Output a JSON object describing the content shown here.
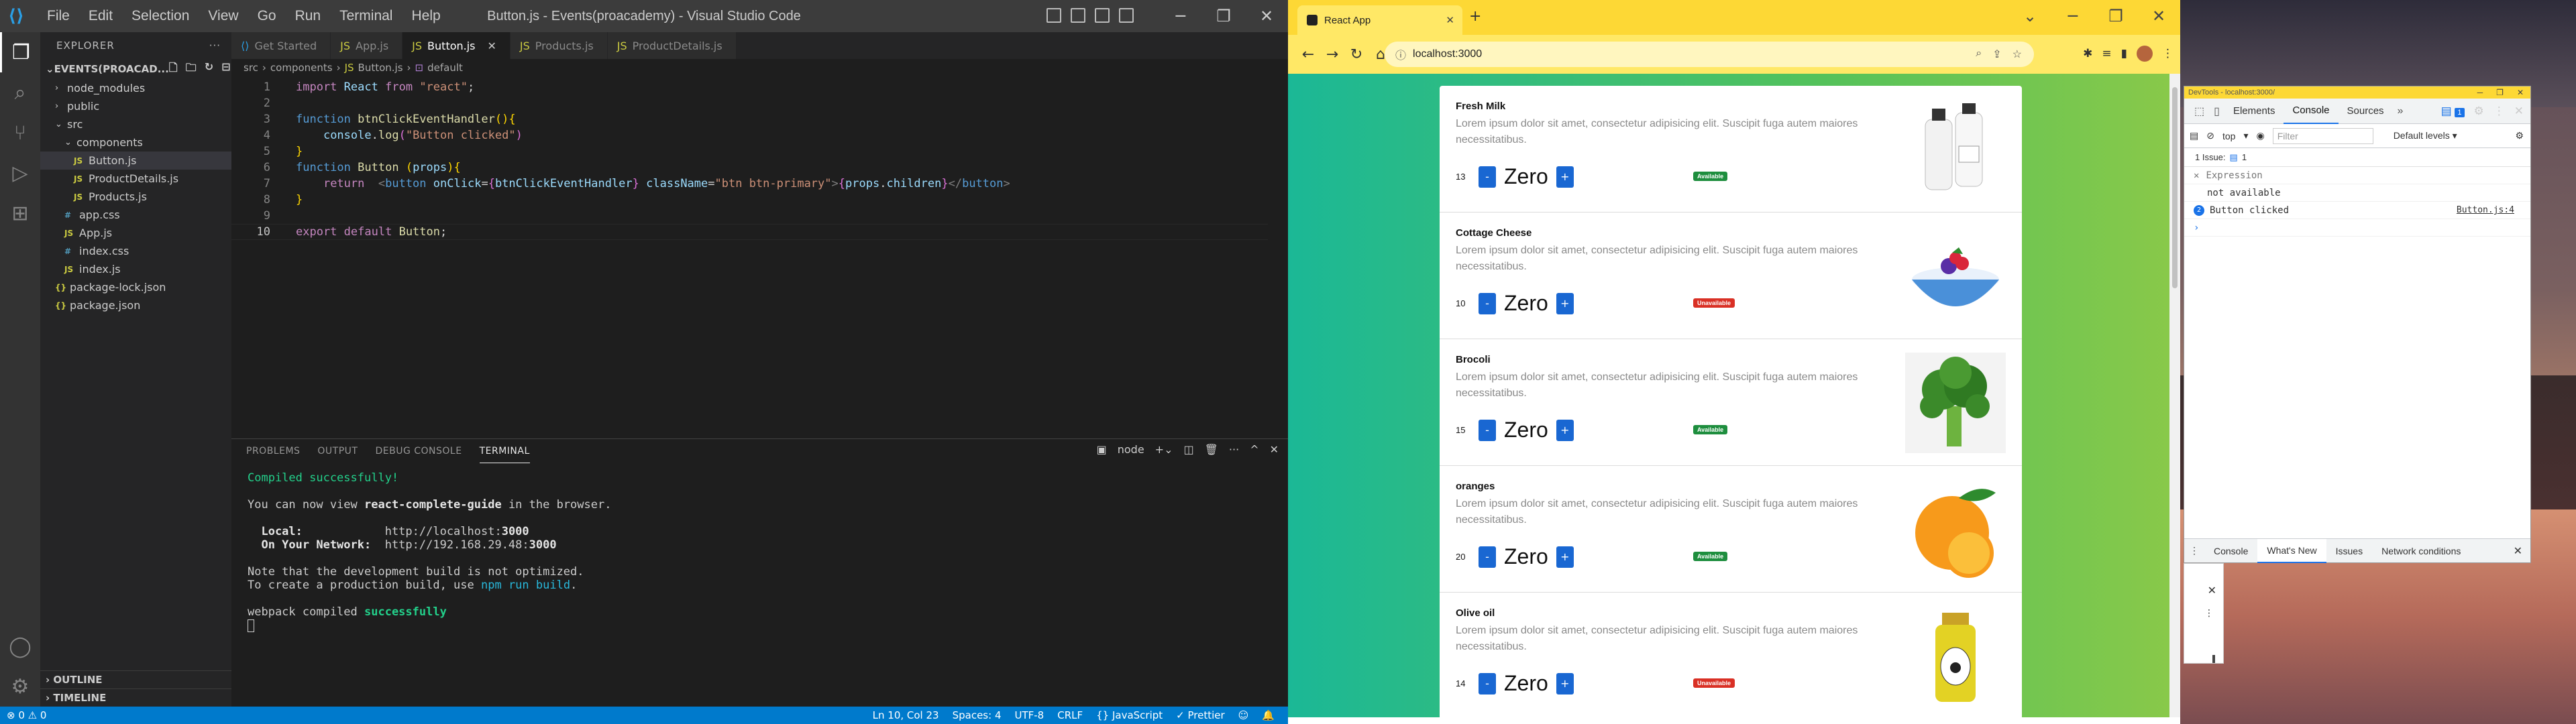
{
  "vscode": {
    "title": "Button.js - Events(proacademy) - Visual Studio Code",
    "menu": [
      "File",
      "Edit",
      "Selection",
      "View",
      "Go",
      "Run",
      "Terminal",
      "Help"
    ],
    "explorer_label": "EXPLORER",
    "folder_name": "EVENTS(PROACAD...",
    "tree": [
      {
        "label": "node_modules",
        "type": "folder",
        "indent": 1
      },
      {
        "label": "public",
        "type": "folder",
        "indent": 1
      },
      {
        "label": "src",
        "type": "folder-open",
        "indent": 1
      },
      {
        "label": "components",
        "type": "folder-open",
        "indent": 2
      },
      {
        "label": "Button.js",
        "type": "js",
        "indent": 3,
        "selected": true
      },
      {
        "label": "ProductDetails.js",
        "type": "js",
        "indent": 3
      },
      {
        "label": "Products.js",
        "type": "js",
        "indent": 3
      },
      {
        "label": "app.css",
        "type": "css",
        "indent": 2
      },
      {
        "label": "App.js",
        "type": "js",
        "indent": 2
      },
      {
        "label": "index.css",
        "type": "css",
        "indent": 2
      },
      {
        "label": "index.js",
        "type": "js",
        "indent": 2
      },
      {
        "label": "package-lock.json",
        "type": "json",
        "indent": 1
      },
      {
        "label": "package.json",
        "type": "json",
        "indent": 1
      }
    ],
    "outline_label": "OUTLINE",
    "timeline_label": "TIMELINE",
    "tabs": [
      {
        "label": "Get Started",
        "icon": "vscode-icon"
      },
      {
        "label": "App.js",
        "icon": "js"
      },
      {
        "label": "Button.js",
        "icon": "js",
        "active": true
      },
      {
        "label": "Products.js",
        "icon": "js"
      },
      {
        "label": "ProductDetails.js",
        "icon": "js"
      }
    ],
    "breadcrumb": [
      "src",
      "components",
      "Button.js",
      "default"
    ],
    "line_numbers": [
      "1",
      "2",
      "3",
      "4",
      "5",
      "6",
      "7",
      "8",
      "9",
      "10"
    ],
    "panel_tabs": [
      "PROBLEMS",
      "OUTPUT",
      "DEBUG CONSOLE",
      "TERMINAL"
    ],
    "terminal_shell": "node",
    "terminal": {
      "compiled": "Compiled successfully!",
      "view_pre": "You can now view ",
      "view_app": "react-complete-guide",
      "view_post": " in the browser.",
      "local_label": "  Local:",
      "local_url_pre": "            http://localhost:",
      "local_port": "3000",
      "network_label": "  On Your Network:",
      "network_url_pre": "  http://192.168.29.48:",
      "network_port": "3000",
      "note1": "Note that the development build is not optimized.",
      "note2_pre": "To create a production build, use ",
      "note2_cmd": "npm run build",
      "note2_post": ".",
      "webpack_pre": "webpack compiled ",
      "webpack_ok": "successfully"
    },
    "status": {
      "errors": "⊗ 0  ⚠ 0",
      "position": "Ln 10, Col 23",
      "spaces": "Spaces: 4",
      "encoding": "UTF-8",
      "eol": "CRLF",
      "language": "{} JavaScript",
      "prettier": "✓ Prettier"
    }
  },
  "browser": {
    "tab_title": "React App",
    "url": "localhost:3000",
    "products": [
      {
        "name": "Fresh Milk",
        "desc": "Lorem ipsum dolor sit amet, consectetur adipisicing elit. Suscipit fuga autem maiores necessitatibus.",
        "qty": "13",
        "value": "Zero",
        "status": "Available",
        "available": true,
        "image": "milk-bottles"
      },
      {
        "name": "Cottage Cheese",
        "desc": "Lorem ipsum dolor sit amet, consectetur adipisicing elit. Suscipit fuga autem maiores necessitatibus.",
        "qty": "10",
        "value": "Zero",
        "status": "Unavailable",
        "available": false,
        "image": "cheese-bowl"
      },
      {
        "name": "Brocoli",
        "desc": "Lorem ipsum dolor sit amet, consectetur adipisicing elit. Suscipit fuga autem maiores necessitatibus.",
        "qty": "15",
        "value": "Zero",
        "status": "Available",
        "available": true,
        "image": "broccoli"
      },
      {
        "name": "oranges",
        "desc": "Lorem ipsum dolor sit amet, consectetur adipisicing elit. Suscipit fuga autem maiores necessitatibus.",
        "qty": "20",
        "value": "Zero",
        "status": "Available",
        "available": true,
        "image": "orange"
      },
      {
        "name": "Olive oil",
        "desc": "Lorem ipsum dolor sit amet, consectetur adipisicing elit. Suscipit fuga autem maiores necessitatibus.",
        "qty": "14",
        "value": "Zero",
        "status": "Unavailable",
        "available": false,
        "image": "olive-oil-bottle"
      }
    ],
    "minus_label": "-",
    "plus_label": "+"
  },
  "devtools": {
    "title": "DevTools - localhost:3000/",
    "tabs": [
      "Elements",
      "Console",
      "Sources"
    ],
    "active_tab": "Console",
    "issue_count": "1",
    "context": "top",
    "filter_placeholder": "Filter",
    "levels": "Default levels ▾",
    "issues_bar": "1 Issue:",
    "issues_bar_count": "1",
    "expression_label": "Expression",
    "expression_value": "not available",
    "log_count": "2",
    "log_message": "Button clicked",
    "log_source": "Button.js:4",
    "drawer_tabs": [
      "Console",
      "What's New",
      "Issues",
      "Network conditions"
    ],
    "drawer_active": "What's New"
  }
}
